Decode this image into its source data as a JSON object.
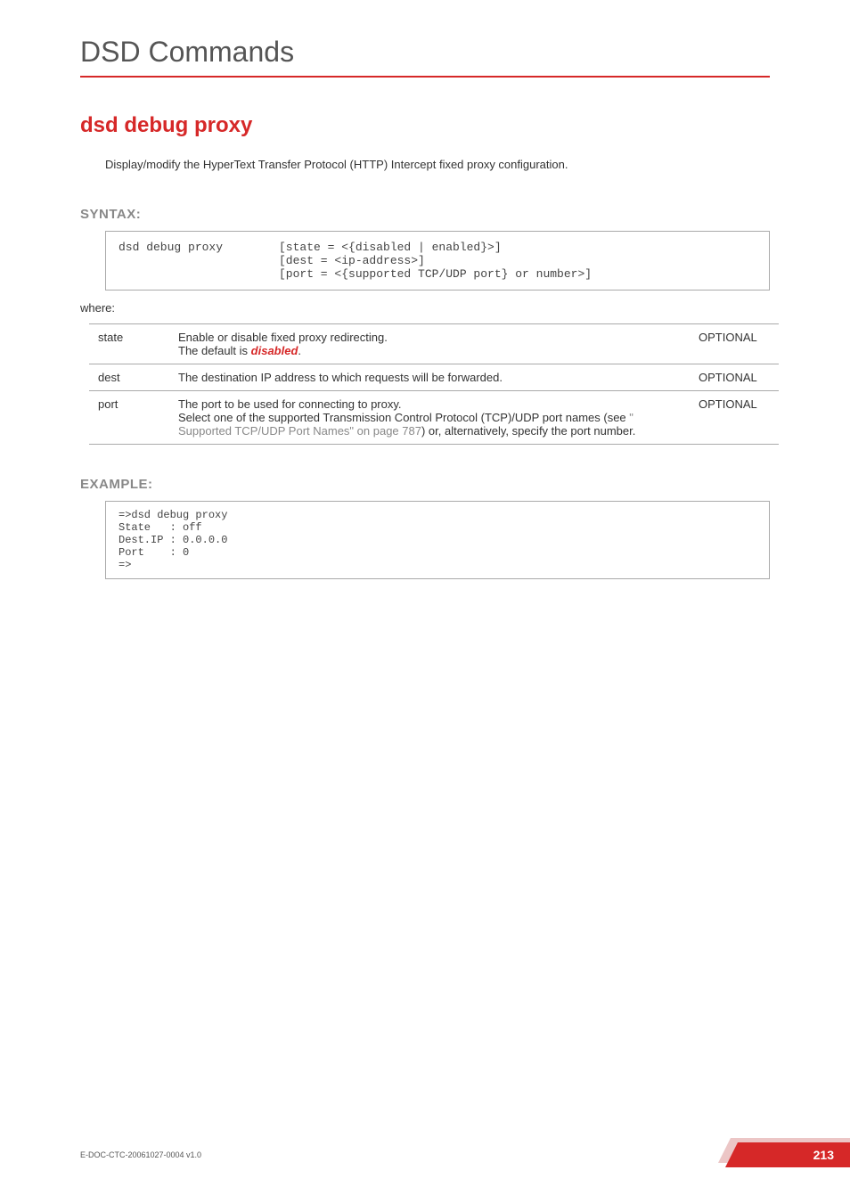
{
  "header": {
    "title": "DSD Commands"
  },
  "section": {
    "title": "dsd debug proxy"
  },
  "intro": "Display/modify the HyperText Transfer Protocol (HTTP) Intercept fixed proxy configuration.",
  "syntax": {
    "label": "SYNTAX:",
    "cmd": "dsd debug proxy",
    "args": "[state = <{disabled | enabled}>]\n[dest = <ip-address>]\n[port = <{supported TCP/UDP port} or number>]"
  },
  "where": "where:",
  "params": [
    {
      "name": "state",
      "desc_pre": "Enable or disable fixed proxy redirecting.\nThe default is ",
      "desc_red": "disabled",
      "desc_post": ".",
      "opt": "OPTIONAL"
    },
    {
      "name": "dest",
      "desc_pre": "The destination IP address to which requests will be forwarded.",
      "desc_red": "",
      "desc_post": "",
      "opt": "OPTIONAL"
    },
    {
      "name": "port",
      "desc_pre": "The port to be used for connecting to proxy.\nSelect one of the supported Transmission Control Protocol (TCP)/UDP port names (see ",
      "desc_grey": "\" Supported TCP/UDP Port Names\" on page 787",
      "desc_post": ") or, alternatively, specify the port number.",
      "opt": "OPTIONAL"
    }
  ],
  "example": {
    "label": "EXAMPLE:",
    "text": "=>dsd debug proxy\nState   : off\nDest.IP : 0.0.0.0\nPort    : 0\n=>"
  },
  "footer": {
    "docid": "E-DOC-CTC-20061027-0004 v1.0",
    "page": "213"
  }
}
